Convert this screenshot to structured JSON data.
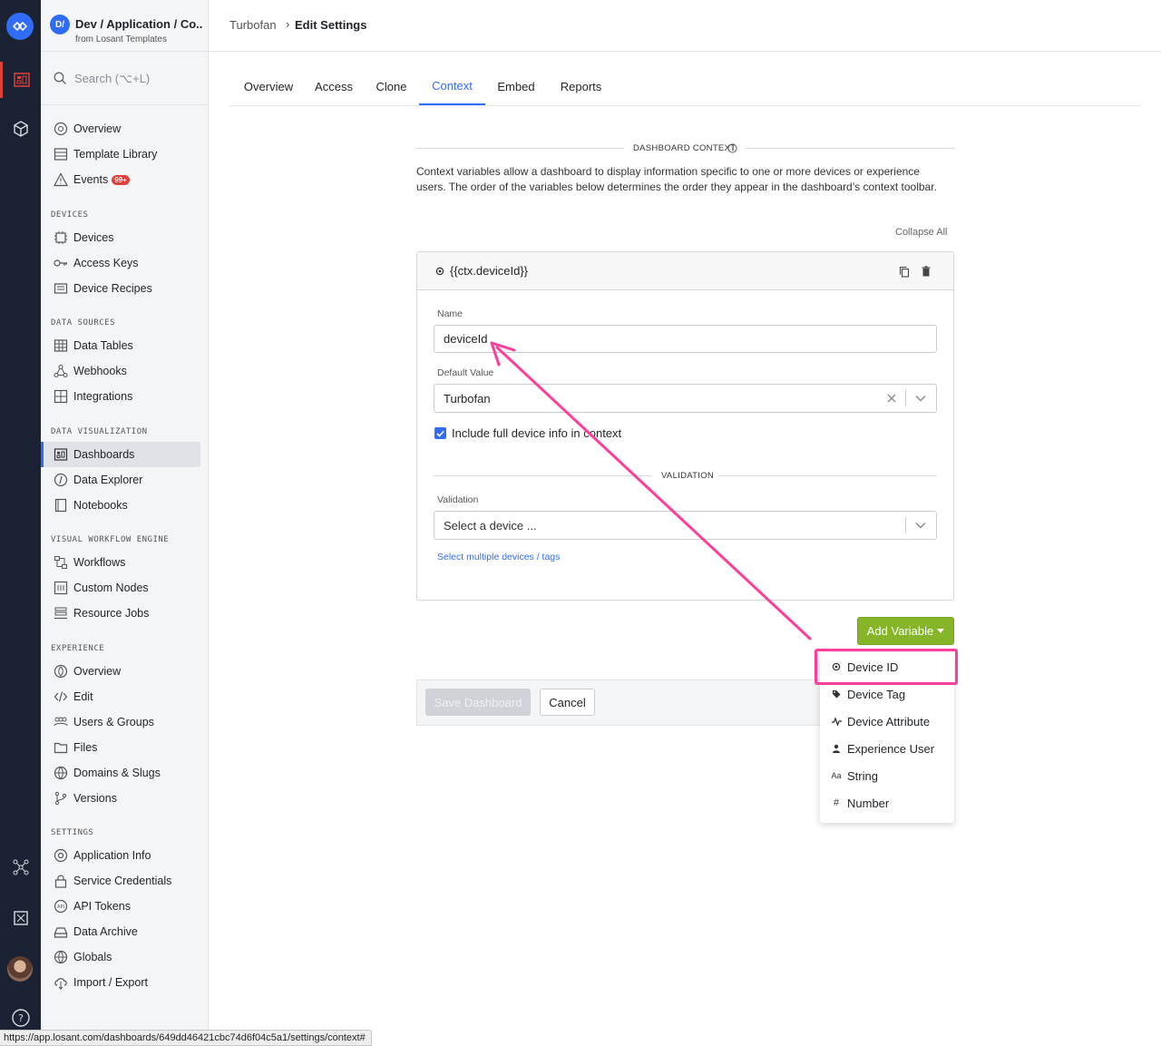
{
  "app": {
    "badge": "D/",
    "name": "Dev / Application / Co...",
    "subtitle": "from Losant Templates"
  },
  "search": {
    "placeholder": "Search (⌥+L)"
  },
  "sidebar": {
    "top": [
      {
        "label": "Overview",
        "icon": "overview-icon"
      },
      {
        "label": "Template Library",
        "icon": "template-library-icon"
      },
      {
        "label": "Events",
        "icon": "events-icon",
        "badge": "99+"
      }
    ],
    "devices_header": "DEVICES",
    "devices": [
      {
        "label": "Devices",
        "icon": "chip-icon"
      },
      {
        "label": "Access Keys",
        "icon": "key-icon"
      },
      {
        "label": "Device Recipes",
        "icon": "recipe-icon"
      }
    ],
    "data_sources_header": "DATA SOURCES",
    "data_sources": [
      {
        "label": "Data Tables",
        "icon": "table-icon"
      },
      {
        "label": "Webhooks",
        "icon": "webhook-icon"
      },
      {
        "label": "Integrations",
        "icon": "integrations-icon"
      }
    ],
    "data_viz_header": "DATA VISUALIZATION",
    "data_viz": [
      {
        "label": "Dashboards",
        "icon": "dashboard-icon"
      },
      {
        "label": "Data Explorer",
        "icon": "explorer-icon"
      },
      {
        "label": "Notebooks",
        "icon": "notebook-icon"
      }
    ],
    "vwe_header": "VISUAL WORKFLOW ENGINE",
    "vwe": [
      {
        "label": "Workflows",
        "icon": "workflow-icon"
      },
      {
        "label": "Custom Nodes",
        "icon": "custom-nodes-icon"
      },
      {
        "label": "Resource Jobs",
        "icon": "resource-jobs-icon"
      }
    ],
    "experience_header": "EXPERIENCE",
    "experience": [
      {
        "label": "Overview",
        "icon": "experience-overview-icon"
      },
      {
        "label": "Edit",
        "icon": "code-icon"
      },
      {
        "label": "Users & Groups",
        "icon": "users-icon"
      },
      {
        "label": "Files",
        "icon": "folder-icon"
      },
      {
        "label": "Domains & Slugs",
        "icon": "domain-icon"
      },
      {
        "label": "Versions",
        "icon": "branch-icon"
      }
    ],
    "settings_header": "SETTINGS",
    "settings": [
      {
        "label": "Application Info",
        "icon": "gear-icon"
      },
      {
        "label": "Service Credentials",
        "icon": "lock-icon"
      },
      {
        "label": "API Tokens",
        "icon": "api-token-icon"
      },
      {
        "label": "Data Archive",
        "icon": "archive-icon"
      },
      {
        "label": "Globals",
        "icon": "globe-icon"
      },
      {
        "label": "Import / Export",
        "icon": "import-export-icon"
      }
    ]
  },
  "breadcrumb": {
    "parent": "Turbofan",
    "separator": "›",
    "current": "Edit Settings"
  },
  "tabs": [
    "Overview",
    "Access",
    "Clone",
    "Context",
    "Embed",
    "Reports"
  ],
  "active_tab": "Context",
  "context": {
    "section_title": "DASHBOARD CONTEXT",
    "description": "Context variables allow a dashboard to display information specific to one or more devices or experience users. The order of the variables below determines the order they appear in the dashboard’s context toolbar.",
    "collapse_all": "Collapse All",
    "variable": {
      "title": "{{ctx.deviceId}}",
      "name_label": "Name",
      "name_value": "deviceId",
      "default_label": "Default Value",
      "default_value": "Turbofan",
      "include_full_info": "Include full device info in context",
      "validation_section": "VALIDATION",
      "validation_label": "Validation",
      "validation_placeholder": "Select a device ...",
      "multi_link": "Select multiple devices / tags"
    },
    "add_variable": "Add Variable",
    "add_menu": [
      {
        "label": "Device ID",
        "icon": "device-id-icon"
      },
      {
        "label": "Device Tag",
        "icon": "tag-icon"
      },
      {
        "label": "Device Attribute",
        "icon": "attribute-icon"
      },
      {
        "label": "Experience User",
        "icon": "user-icon"
      },
      {
        "label": "String",
        "icon": "string-icon"
      },
      {
        "label": "Number",
        "icon": "hash-icon"
      }
    ]
  },
  "footer": {
    "save": "Save Dashboard",
    "cancel": "Cancel"
  },
  "status_url": "https://app.losant.com/dashboards/649dd46421cbc74d6f04c5a1/settings/context#",
  "colors": {
    "accent": "#2f6df6",
    "add_button": "#86b52a",
    "highlight": "#ff3d9a",
    "rail": "#1b2233"
  }
}
